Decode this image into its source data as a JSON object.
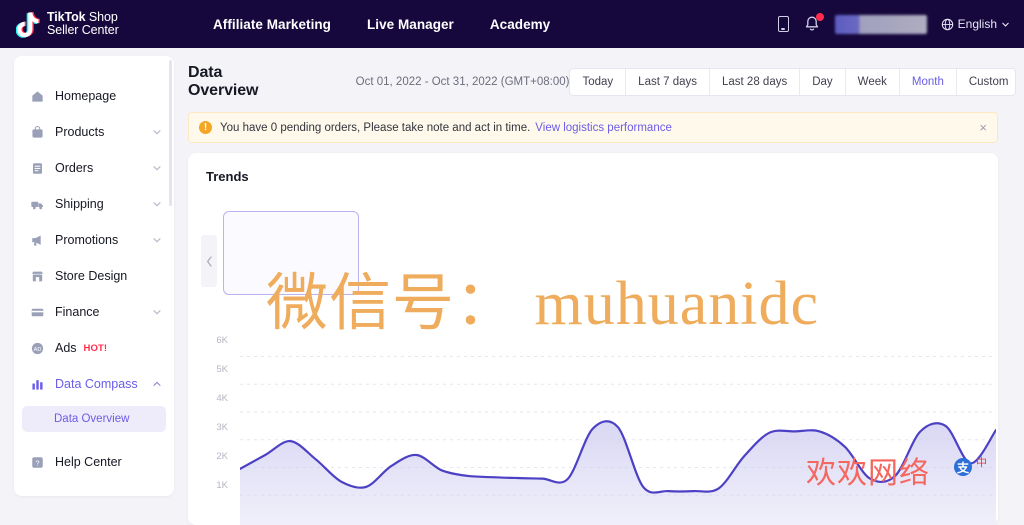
{
  "header": {
    "logo_line1_bold": "TikTok",
    "logo_line1_rest": " Shop",
    "logo_line2": "Seller Center",
    "nav": [
      {
        "label": "Affiliate Marketing"
      },
      {
        "label": "Live Manager"
      },
      {
        "label": "Academy"
      }
    ],
    "language": "English",
    "icons": {
      "phone": "phone-icon",
      "bell": "bell-icon",
      "globe": "globe-icon"
    },
    "bg_color": "#16083c"
  },
  "sidebar": {
    "items": [
      {
        "label": "Homepage",
        "icon": "home-icon",
        "expandable": false,
        "active": false
      },
      {
        "label": "Products",
        "icon": "bag-icon",
        "expandable": true,
        "active": false
      },
      {
        "label": "Orders",
        "icon": "document-icon",
        "expandable": true,
        "active": false
      },
      {
        "label": "Shipping",
        "icon": "truck-icon",
        "expandable": true,
        "active": false
      },
      {
        "label": "Promotions",
        "icon": "megaphone-icon",
        "expandable": true,
        "active": false
      },
      {
        "label": "Store Design",
        "icon": "store-icon",
        "expandable": false,
        "active": false
      },
      {
        "label": "Finance",
        "icon": "card-icon",
        "expandable": true,
        "active": false
      },
      {
        "label": "Ads",
        "icon": "ads-icon",
        "expandable": false,
        "active": false,
        "badge": "HOT!"
      },
      {
        "label": "Data Compass",
        "icon": "bar-chart-icon",
        "expandable": true,
        "active": true,
        "expanded": true
      }
    ],
    "subitem": {
      "label": "Data Overview",
      "selected": true
    },
    "footer_item": {
      "label": "Help Center",
      "icon": "help-icon"
    },
    "active_color": "#6c5ce7",
    "badge_color": "#ff2d4b"
  },
  "page": {
    "title": "Data Overview",
    "date_range": "Oct 01, 2022 - Oct 31, 2022 (GMT+08:00)",
    "range_buttons": [
      {
        "label": "Today",
        "active": false
      },
      {
        "label": "Last 7 days",
        "active": false
      },
      {
        "label": "Last 28 days",
        "active": false
      },
      {
        "label": "Day",
        "active": false
      },
      {
        "label": "Week",
        "active": false
      },
      {
        "label": "Month",
        "active": true
      },
      {
        "label": "Custom",
        "active": false
      }
    ]
  },
  "alert": {
    "icon": "warning-icon",
    "icon_glyph": "!",
    "message": "You have 0 pending orders, Please take note and act in time.",
    "link_label": "View logistics performance",
    "close_label": "×",
    "bg_color": "#fff9ec",
    "accent_color": "#f5a623"
  },
  "trends_card": {
    "title": "Trends",
    "prev_arrow": "chevron-left-icon"
  },
  "watermarks": {
    "orange_text": "微信号： muhuanidc",
    "orange_color": "#eeac5c",
    "red_text": "欢欢网络",
    "red_color": "#f4675f",
    "badge_glyph": "支",
    "badge2_glyph": "中"
  },
  "chart_data": {
    "type": "area",
    "title": "Trends",
    "xlabel": "",
    "ylabel": "",
    "ylim": [
      0,
      6500
    ],
    "grid": true,
    "legend": null,
    "line_color": "#4c40c4",
    "fill_color": "#e4e2f6",
    "ytick_labels": [
      "6K",
      "5K",
      "4K",
      "3K",
      "2K",
      "1K"
    ],
    "ytick_values": [
      6000,
      5000,
      4000,
      3000,
      2000,
      1000
    ],
    "x": [
      1,
      2,
      3,
      4,
      5,
      6,
      7,
      8,
      9,
      10,
      11,
      12,
      13,
      14,
      15,
      16,
      17,
      18,
      19,
      20,
      21,
      22,
      23,
      24,
      25,
      26,
      27,
      28,
      29,
      30,
      31
    ],
    "series": [
      {
        "name": "Trend",
        "values": [
          1950,
          2450,
          2950,
          2300,
          1500,
          1300,
          2050,
          2450,
          1900,
          1700,
          1650,
          1620,
          1600,
          1580,
          3400,
          3450,
          1300,
          1150,
          1150,
          1250,
          2400,
          3250,
          3300,
          3300,
          2750,
          1600,
          1700,
          3300,
          3500,
          2150,
          3350
        ]
      }
    ]
  }
}
